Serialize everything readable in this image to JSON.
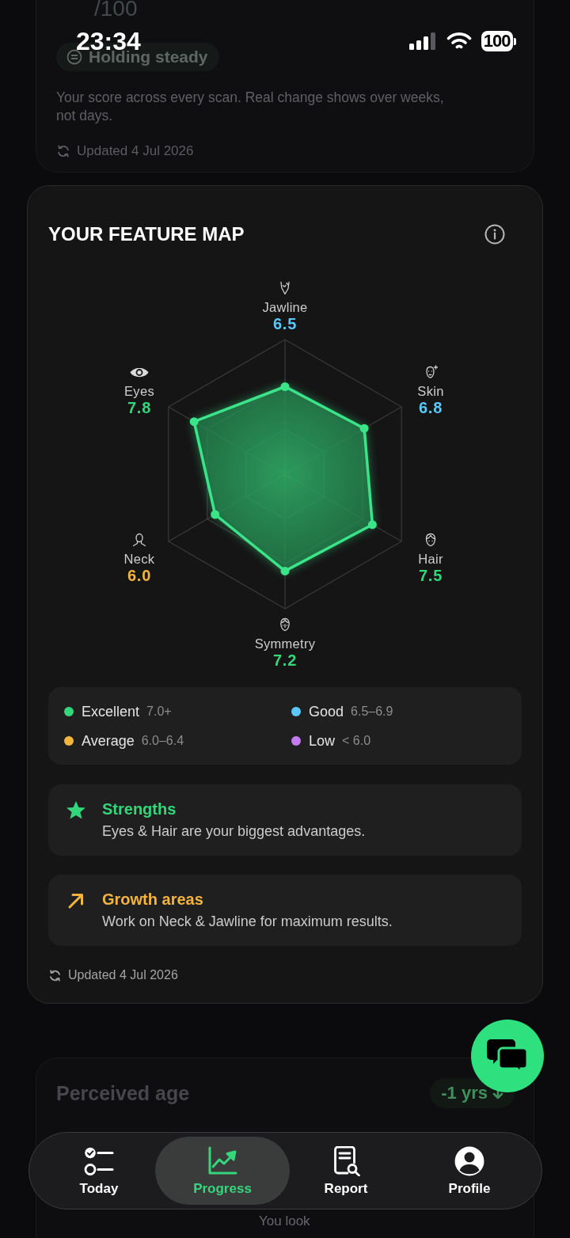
{
  "status_bar": {
    "time": "23:34",
    "battery": "100"
  },
  "score_card": {
    "max_score": "/100",
    "trend": "Holding steady",
    "description": "Your score across every scan. Real change shows over weeks, not days.",
    "updated": "Updated 4 Jul 2026"
  },
  "feature_map": {
    "title": "YOUR FEATURE MAP",
    "features": [
      {
        "kind": "jawline",
        "name": "Jawline",
        "score": "6.5",
        "color": "#5ac8fa"
      },
      {
        "kind": "skin",
        "name": "Skin",
        "score": "6.8",
        "color": "#5ac8fa"
      },
      {
        "kind": "hair",
        "name": "Hair",
        "score": "7.5",
        "color": "#34d67b"
      },
      {
        "kind": "symmetry",
        "name": "Symmetry",
        "score": "7.2",
        "color": "#34d67b"
      },
      {
        "kind": "neck",
        "name": "Neck",
        "score": "6.0",
        "color": "#f5b43c"
      },
      {
        "kind": "eyes",
        "name": "Eyes",
        "score": "7.8",
        "color": "#34d67b"
      }
    ],
    "legend": [
      {
        "name": "Excellent",
        "range": "7.0+",
        "color": "#34d67b"
      },
      {
        "name": "Good",
        "range": "6.5–6.9",
        "color": "#5ac8fa"
      },
      {
        "name": "Average",
        "range": "6.0–6.4",
        "color": "#f5b43c"
      },
      {
        "name": "Low",
        "range": "< 6.0",
        "color": "#c27cf0"
      }
    ],
    "insights": [
      {
        "kind": "strength",
        "title": "Strengths",
        "text": "Eyes & Hair are your biggest advantages.",
        "color": "#34d67b"
      },
      {
        "kind": "growth",
        "title": "Growth areas",
        "text": "Work on Neck & Jawline for maximum results.",
        "color": "#f5b43c"
      }
    ],
    "updated": "Updated 4 Jul 2026"
  },
  "perceived_age": {
    "title": "Perceived age",
    "delta": "-1 yrs",
    "caption": "You look"
  },
  "nav": [
    {
      "kind": "today",
      "label": "Today",
      "selected": false
    },
    {
      "kind": "progress",
      "label": "Progress",
      "selected": true
    },
    {
      "kind": "report",
      "label": "Report",
      "selected": false
    },
    {
      "kind": "profile",
      "label": "Profile",
      "selected": false
    }
  ]
}
